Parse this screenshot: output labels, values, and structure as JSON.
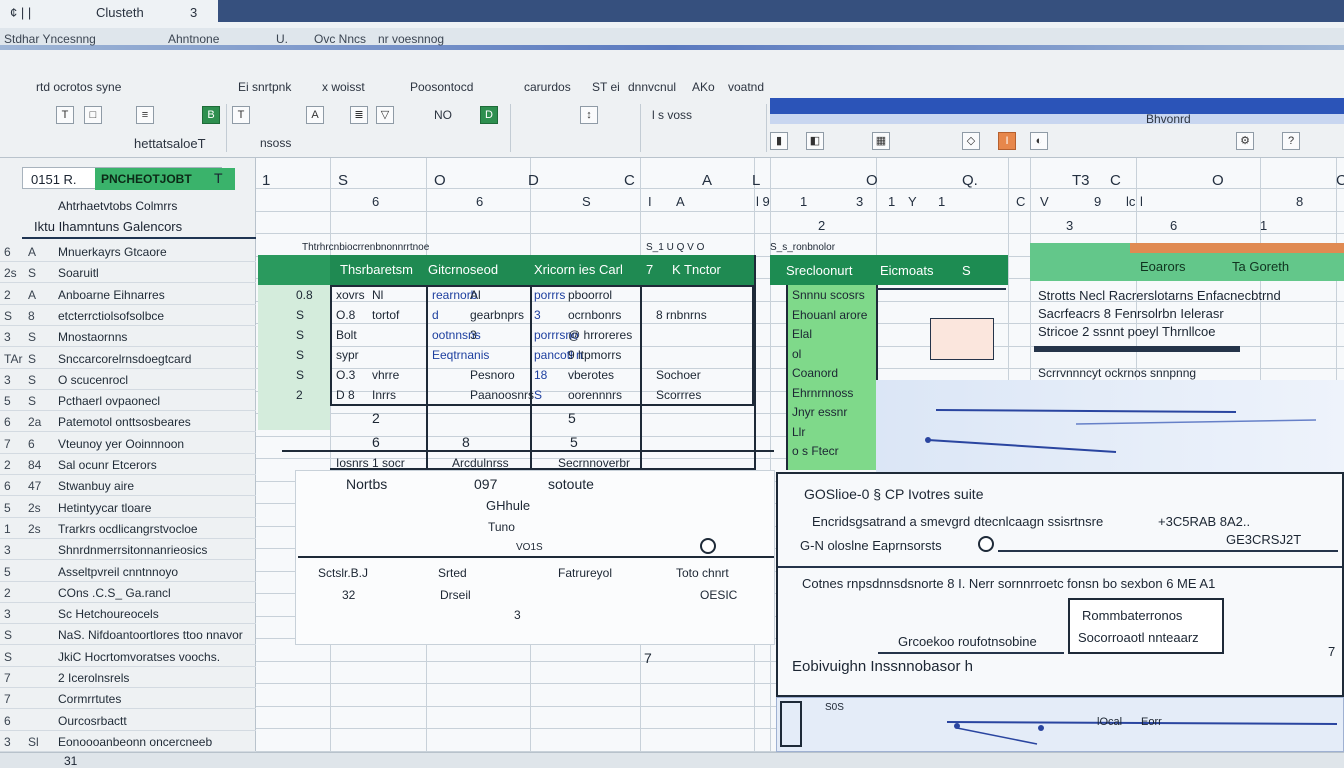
{
  "titlebar": {
    "app_title": "Clusteth",
    "left_glyphs": "¢ | |",
    "right_glyph": "3"
  },
  "menubar": {
    "items": [
      "Stdhar Yncesnng",
      "Ahntnone",
      "U.",
      "Ovc Nncs",
      "nr voesnnog"
    ]
  },
  "ribbon": {
    "row1": [
      "rtd ocrotos syne",
      "Ei snrtpnk",
      "x woisst",
      "Poosontocd",
      "carurdos",
      "ST ei",
      "dnnvcnul",
      "AKo",
      "voatnd"
    ],
    "name_box_label": "hettatsaloeT",
    "group_labels": [
      "nsoss",
      "NO",
      "l s voss"
    ],
    "far_right_label": "Bhvonrd"
  },
  "namebox": {
    "left": "0151 R.",
    "value": "PNCHEOTJOBT",
    "suffix": "T"
  },
  "left_panel": {
    "header_line1": "Ahtrhaetvtobs Colmrrs",
    "header_line2": "Iktu Ihamntuns Galencors",
    "rows": [
      {
        "num": "6",
        "sub": "A",
        "text": "Mnuerkayrs Gtcaore"
      },
      {
        "num": "2s",
        "sub": "S",
        "text": "Soaruitl"
      },
      {
        "num": "2",
        "sub": "A",
        "text": "Anboarne Eihnarres"
      },
      {
        "num": "S",
        "sub": "8",
        "text": "etcterrctiolsofsolbce"
      },
      {
        "num": "3",
        "sub": "S",
        "text": "Mnostaornns"
      },
      {
        "num": "TAr",
        "sub": "S",
        "text": "Snccarcorelrnsdoegtcard"
      },
      {
        "num": "3",
        "sub": "S",
        "text": "O scucenrocl"
      },
      {
        "num": "5",
        "sub": "S",
        "text": "Pcthaerl ovpaonecl"
      },
      {
        "num": "6",
        "sub": "2a",
        "text": "Patemotol onttsosbeares"
      },
      {
        "num": "7",
        "sub": "6",
        "text": "Vteunoy yer Ooinnnoon"
      },
      {
        "num": "2",
        "sub": "84",
        "text": "Sal ocunr Etcerors"
      },
      {
        "num": "6",
        "sub": "47",
        "text": "Stwanbuy aire"
      },
      {
        "num": "5",
        "sub": "2s",
        "text": "Hetintyycar tloare"
      },
      {
        "num": "1",
        "sub": "2s",
        "text": "Trarkrs ocdlicangrstvocloe"
      },
      {
        "num": "3",
        "sub": "",
        "text": "Shnrdnmerrsitonnanrieosics"
      },
      {
        "num": "5",
        "sub": "",
        "text": "Asseltpvreil cnntnnoyo"
      },
      {
        "num": "2",
        "sub": "",
        "text": "COns .C.S_ Ga.rancl"
      },
      {
        "num": "3",
        "sub": "",
        "text": "Sc Hetchoureocels"
      },
      {
        "num": "S",
        "sub": "",
        "text": "NaS. Nifdoantoortlores ttoo nnavor"
      },
      {
        "num": "S",
        "sub": "",
        "text": "JkiC Hocrtomvoratses voochs."
      },
      {
        "num": "7",
        "sub": "",
        "text": "2 Icerolnsrels"
      },
      {
        "num": "7",
        "sub": "",
        "text": "Cormrrtutes"
      },
      {
        "num": "6",
        "sub": "",
        "text": "Ourcosrbactt"
      },
      {
        "num": "3",
        "sub": "Sl",
        "text": "Eonoooanbeonn oncercneeb"
      }
    ]
  },
  "columns": {
    "row1": [
      "1",
      "S",
      "O",
      "D",
      "C",
      "A",
      "L",
      "O",
      "Q.",
      "T3",
      "C",
      "O",
      "C"
    ],
    "row2": [
      "6",
      "6",
      "S",
      "I",
      "A",
      "l 9",
      "1",
      "3",
      "1",
      "Y",
      "1",
      "C",
      "V",
      "9",
      "lc",
      "l",
      "8"
    ],
    "row3": [
      "2",
      "3",
      "6",
      "1",
      "5"
    ]
  },
  "table1": {
    "tiny_headers": [
      "Thtrhrcnbiocrrenbnonnrrtnoe",
      "S_1 U Q V O",
      "S_s_ronbnolor"
    ],
    "header": [
      "Thsrbaretsm",
      "Gitcrnoseod",
      "Xricorn ies Carl",
      "7",
      "K Tnctor"
    ],
    "rows": [
      [
        "0.8",
        "xovrs",
        "Nl",
        "rearnorb",
        "Al",
        "porrrs",
        "pboorrol"
      ],
      [
        "S",
        "O.8",
        "tortof",
        "d",
        "gearbnprs",
        "3",
        "ocrnbonrs",
        "8 rnbnrns"
      ],
      [
        "S",
        "Bolt",
        "",
        "ootnnsns",
        "3",
        "porrrsno",
        "@ hrroreres"
      ],
      [
        "S",
        "sypr",
        "",
        "Eeqtrnanis",
        "",
        "pancotl n",
        "9 ltpmorrs"
      ],
      [
        "S",
        "O.3",
        "vhrre",
        "",
        "Pesnoro",
        "18",
        "vberotes",
        "Sochoer"
      ],
      [
        "2",
        "D 8",
        "Inrrs",
        "",
        "Paanoosnrs",
        "S",
        "oorennnrs",
        "Scorrres"
      ]
    ],
    "footer": [
      "2",
      "5"
    ],
    "footer2": [
      "6",
      "8",
      "5"
    ],
    "sub_labels": [
      "Iosnrs 1 socr",
      "Arcdulnrss",
      "Secrnnoverbr"
    ]
  },
  "greencol": {
    "header": "Srecloonurt",
    "header2": "Eicmoats",
    "header3": "S",
    "rows": [
      "Snnnu scosrs",
      "Ehouanl arore",
      "Elal",
      "ol",
      "Coanord",
      "Ehrnrnnoss",
      "Jnyr essnr",
      "Llr",
      "o s Ftecr"
    ]
  },
  "right_section": {
    "band_left": "Eoarors",
    "band_right": "Ta Goreth",
    "lines": [
      "Strotts Necl Racrerslotarns Enfacnecbtrnd",
      "Sacrfeacrs 8 Fenrsolrbn Ielerasr",
      "Stricoe 2 ssnnt poeyl Thrnllcoe"
    ],
    "caption": "Scrrvnnncyt ockrnos snnpnng"
  },
  "lower_block": {
    "l1": "Nortbs",
    "l2": "097",
    "l3": "sotoute",
    "l4": "GHhule",
    "l5": "Tuno",
    "l6": "VO1S",
    "l7": "Sctslr.B.J",
    "l8": "Srted",
    "l9": "Fatrureyol",
    "l10": "Toto chnrt",
    "l11": "32",
    "l12": "Drseil",
    "l13": "OESIC",
    "l14": "3",
    "l15": "7"
  },
  "dialog": {
    "title": "GOSlioe-0  §  CP Ivotres suite",
    "line1": "Encridsgsatrand a smevgrd dtecnlcaagn ssisrtnsre",
    "line1_right": "+3C5RAB 8A2..",
    "line2": "G-N oloslne  Eaprnsorsts",
    "line2_right": "GE3CRSJ2T",
    "line3": "Cotnes rnpsdnnsdsnorte  8  I.  Nerr  sornnrroetc fonsn  bo  sexbon 6  ME A1",
    "box1": "Rommbaterronos",
    "box2": "Socorroaotl nnteaarz",
    "line4": "Grcoekoo roufotnsobine",
    "line5": "Eobivuighn  Inssnnobasor h",
    "small": "S0S",
    "right_mark": "7"
  },
  "bottom_panel": {
    "label": "lOcal",
    "label2": "Eorr"
  },
  "status": {
    "left": "31"
  },
  "colors": {
    "accent_green": "#1f8a52",
    "light_green": "#7fd98a",
    "accent_blue": "#2b54b8",
    "orange": "#e7874b"
  }
}
